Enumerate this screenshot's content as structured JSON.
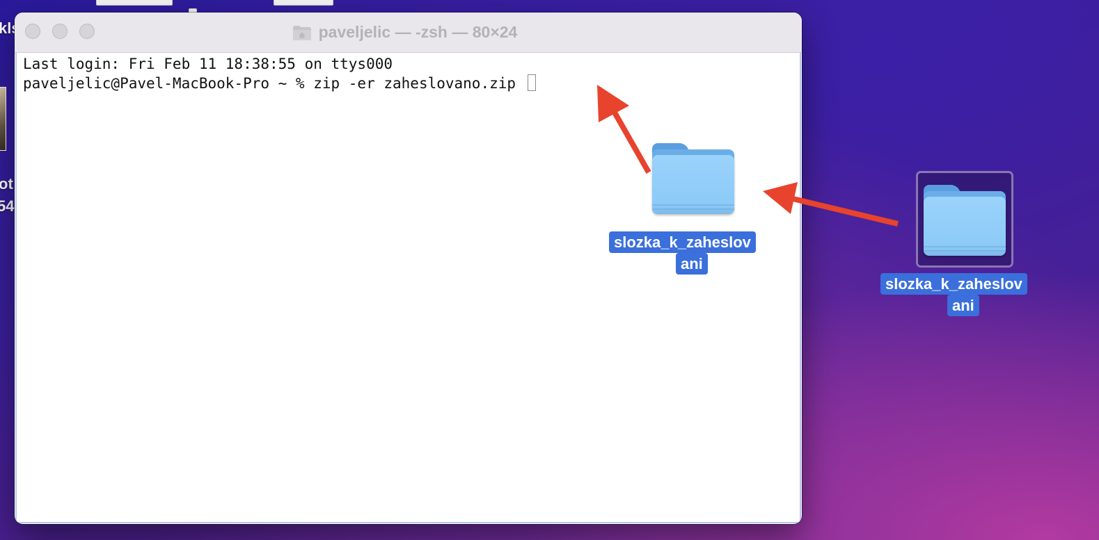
{
  "desktop": {
    "edge_fragments": [
      "kls",
      "ot",
      "54"
    ]
  },
  "terminal": {
    "title": "paveljelic — -zsh — 80×24",
    "lines": [
      "Last login: Fri Feb 11 18:38:55 on ttys000",
      "paveljelic@Pavel-MacBook-Pro ~ % zip -er zaheslovano.zip "
    ]
  },
  "folders": [
    {
      "name_line1": "slozka_k_zaheslov",
      "name_line2": "ani"
    },
    {
      "name_line1": "slozka_k_zaheslov",
      "name_line2": "ani"
    }
  ],
  "colors": {
    "annotation_arrow": "#e8432d",
    "selection_label": "#3a6fdc",
    "folder": "#8ccaf7"
  }
}
